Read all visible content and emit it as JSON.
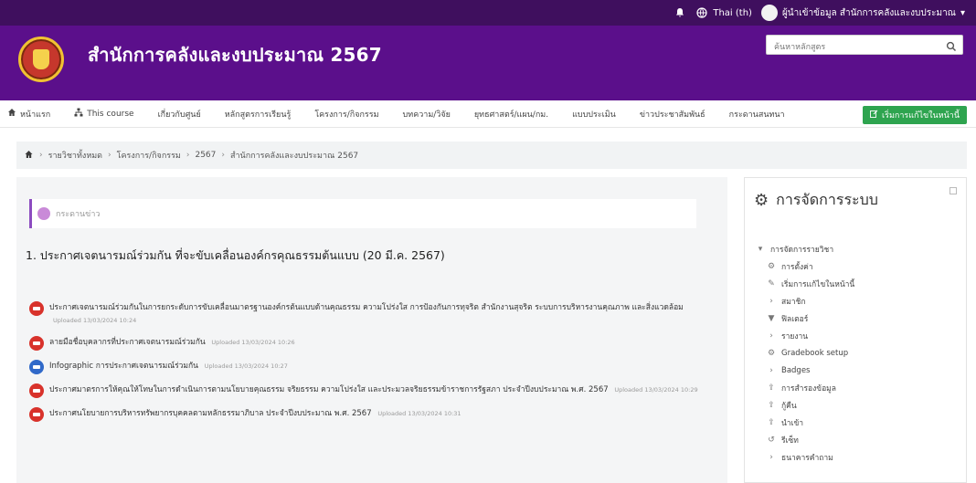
{
  "topbar": {
    "language": "Thai (th)",
    "user_name": "ผู้นำเข้าข้อมูล สำนักการคลังและงบประมาณ"
  },
  "header": {
    "site_title": "สำนักการคลังและงบประมาณ 2567",
    "search_placeholder": "ค้นหาหลักสูตร"
  },
  "nav": {
    "items": [
      {
        "label": "หน้าแรก",
        "icon": "home-icon"
      },
      {
        "label": "This course",
        "icon": "sitemap-icon"
      },
      {
        "label": "เกี่ยวกับศูนย์"
      },
      {
        "label": "หลักสูตรการเรียนรู้"
      },
      {
        "label": "โครงการ/กิจกรรม"
      },
      {
        "label": "บทความ/วิจัย"
      },
      {
        "label": "ยุทธศาสตร์/แผน/กม."
      },
      {
        "label": "แบบประเมิน"
      },
      {
        "label": "ข่าวประชาสัมพันธ์"
      },
      {
        "label": "กระดานสนทนา"
      }
    ],
    "edit_button": "เริ่มการแก้ไขในหน้านี้"
  },
  "breadcrumb": [
    "รายวิชาทั้งหมด",
    "โครงการ/กิจกรรม",
    "2567",
    "สำนักการคลังและงบประมาณ 2567"
  ],
  "main": {
    "news_label": "กระดานข่าว",
    "section_title": "1. ประกาศเจตนารมณ์ร่วมกัน ที่จะขับเคลื่อนองค์กรคุณธรรมต้นแบบ (20 มี.ค. 2567)",
    "resources": [
      {
        "type": "pdf",
        "text": "ประกาศเจตนารมณ์ร่วมกันในการยกระดับการขับเคลื่อนมาตรฐานองค์กรต้นแบบด้านคุณธรรม ความโปร่งใส การป้องกันการทุจริต สำนักงานสุจริต ระบบการบริหารงานคุณภาพ และสิ่งแวดล้อม",
        "uploaded": "Uploaded 13/03/2024 10:24"
      },
      {
        "type": "pdf",
        "text": "ลายมือชื่อบุคลากรที่ประกาศเจตนารมณ์ร่วมกัน",
        "uploaded": "Uploaded 13/03/2024 10:26"
      },
      {
        "type": "img",
        "text": "Infographic การประกาศเจตนารมณ์ร่วมกัน",
        "uploaded": "Uploaded 13/03/2024 10:27"
      },
      {
        "type": "pdf",
        "text": "ประกาศมาตรการให้คุณให้โทษในการดำเนินการตามนโยบายคุณธรรม จริยธรรม ความโปร่งใส และประมวลจริยธรรมข้าราชการรัฐสภา ประจำปีงบประมาณ พ.ศ. 2567",
        "uploaded": "Uploaded 13/03/2024 10:29"
      },
      {
        "type": "pdf",
        "text": "ประกาศนโยบายการบริหารทรัพยากรบุคคลตามหลักธรรมาภิบาล ประจำปีงบประมาณ พ.ศ. 2567",
        "uploaded": "Uploaded 13/03/2024 10:31"
      }
    ]
  },
  "aside": {
    "title": "การจัดการระบบ",
    "tree": [
      {
        "label": "การจัดการรายวิชา",
        "icon": "caret-down-icon",
        "level": 0
      },
      {
        "label": "การตั้งค่า",
        "icon": "gear-icon",
        "level": 1
      },
      {
        "label": "เริ่มการแก้ไขในหน้านี้",
        "icon": "pencil-icon",
        "level": 1
      },
      {
        "label": "สมาชิก",
        "icon": "caret-right-icon",
        "level": 1
      },
      {
        "label": "ฟิลเตอร์",
        "icon": "filter-icon",
        "level": 1
      },
      {
        "label": "รายงาน",
        "icon": "caret-right-icon",
        "level": 1
      },
      {
        "label": "Gradebook setup",
        "icon": "gear-icon",
        "level": 1
      },
      {
        "label": "Badges",
        "icon": "caret-right-icon",
        "level": 1
      },
      {
        "label": "การสำรองข้อมูล",
        "icon": "upload-icon",
        "level": 1
      },
      {
        "label": "กู้คืน",
        "icon": "upload-icon",
        "level": 1
      },
      {
        "label": "นำเข้า",
        "icon": "upload-icon",
        "level": 1
      },
      {
        "label": "รีเซ็ท",
        "icon": "reset-icon",
        "level": 1
      },
      {
        "label": "ธนาคารคำถาม",
        "icon": "caret-right-icon",
        "level": 1
      }
    ]
  },
  "colors": {
    "topbar": "#3f0f5e",
    "header": "#5b0f8b",
    "accent_green": "#2ea44f",
    "pdf_red": "#d8322b",
    "image_blue": "#3069c9"
  }
}
